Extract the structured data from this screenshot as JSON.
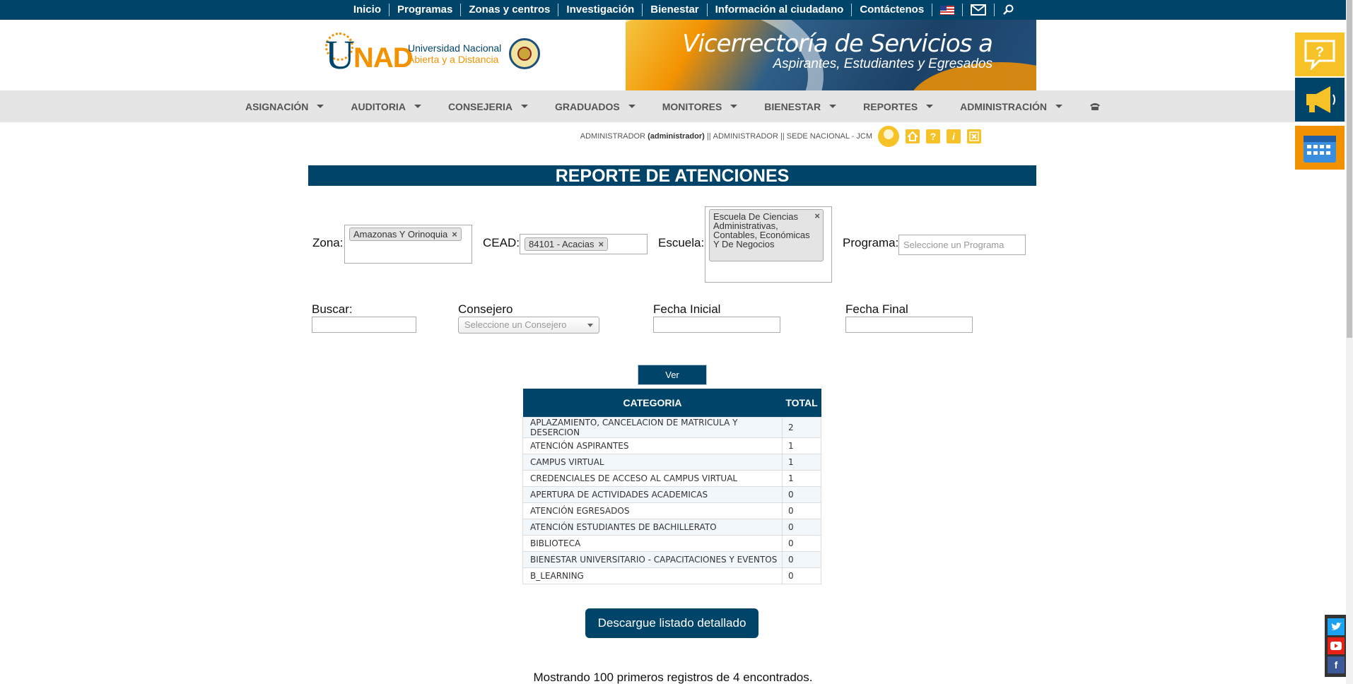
{
  "topnav": {
    "links": [
      "Inicio",
      "Programas",
      "Zonas y centros",
      "Investigación",
      "Bienestar",
      "Información al ciudadano",
      "Contáctenos"
    ]
  },
  "header": {
    "logo_u": "U",
    "logo_nad": "NAD",
    "university_line1": "Universidad Nacional",
    "university_line2": "Abierta y a Distancia",
    "banner_line1": "Vicerrectoría de Servicios a",
    "banner_line2": "Aspirantes, Estudiantes y Egresados"
  },
  "menu": {
    "items": [
      "ASIGNACIÓN",
      "AUDITORIA",
      "CONSEJERIA",
      "GRADUADOS",
      "MONITORES",
      "BIENESTAR",
      "REPORTES",
      "ADMINISTRACIÓN"
    ]
  },
  "user": {
    "role": "ADMINISTRADOR",
    "username": "(administrador)",
    "sep": "||",
    "profile": "ADMINISTRADOR",
    "sede": "SEDE NACIONAL - JCM"
  },
  "report": {
    "title": "REPORTE DE ATENCIONES"
  },
  "filters": {
    "zona_label": "Zona:",
    "zona_tag": "Amazonas Y Orinoquia",
    "cead_label": "CEAD:",
    "cead_tag": "84101 - Acacias",
    "escuela_label": "Escuela:",
    "escuela_tag": "Escuela De Ciencias Administrativas, Contables, Económicas Y De Negocios",
    "programa_label": "Programa:",
    "programa_placeholder": "Seleccione un Programa",
    "buscar_label": "Buscar:",
    "consejero_label": "Consejero",
    "consejero_placeholder": "Seleccione un Consejero",
    "fecha_inicial_label": "Fecha Inicial",
    "fecha_final_label": "Fecha Final",
    "remove_glyph": "×"
  },
  "buttons": {
    "ver": "Ver",
    "descargar": "Descargue listado detallado"
  },
  "table": {
    "headers": [
      "CATEGORIA",
      "TOTAL"
    ],
    "rows": [
      [
        "APLAZAMIENTO, CANCELACION DE MATRICULA Y DESERCION",
        "2"
      ],
      [
        "ATENCIÓN ASPIRANTES",
        "1"
      ],
      [
        "CAMPUS VIRTUAL",
        "1"
      ],
      [
        "CREDENCIALES DE ACCESO AL CAMPUS VIRTUAL",
        "1"
      ],
      [
        "APERTURA DE ACTIVIDADES ACADEMICAS",
        "0"
      ],
      [
        "ATENCIÓN EGRESADOS",
        "0"
      ],
      [
        "ATENCIÓN ESTUDIANTES DE BACHILLERATO",
        "0"
      ],
      [
        "BIBLIOTECA",
        "0"
      ],
      [
        "BIENESTAR UNIVERSITARIO - CAPACITACIONES Y EVENTOS",
        "0"
      ],
      [
        "B_LEARNING",
        "0"
      ]
    ]
  },
  "footer": {
    "records_text": "Mostrando 100 primeros registros de 4 encontrados."
  },
  "icons": {
    "flag": "us-flag-icon",
    "mail": "mail-icon",
    "search": "search-icon",
    "phone": "phone-icon",
    "home": "home-icon",
    "help": "help-icon",
    "info": "info-icon",
    "close": "close-icon",
    "faq": "question-bubble-icon",
    "announce": "megaphone-icon",
    "calendar": "calendar-icon",
    "twitter": "twitter-icon",
    "youtube": "youtube-icon",
    "facebook": "facebook-icon"
  },
  "colors": {
    "primary": "#004469",
    "accent": "#f39200",
    "yellow": "#f6c227",
    "menu_bg": "#e5e5e5"
  }
}
